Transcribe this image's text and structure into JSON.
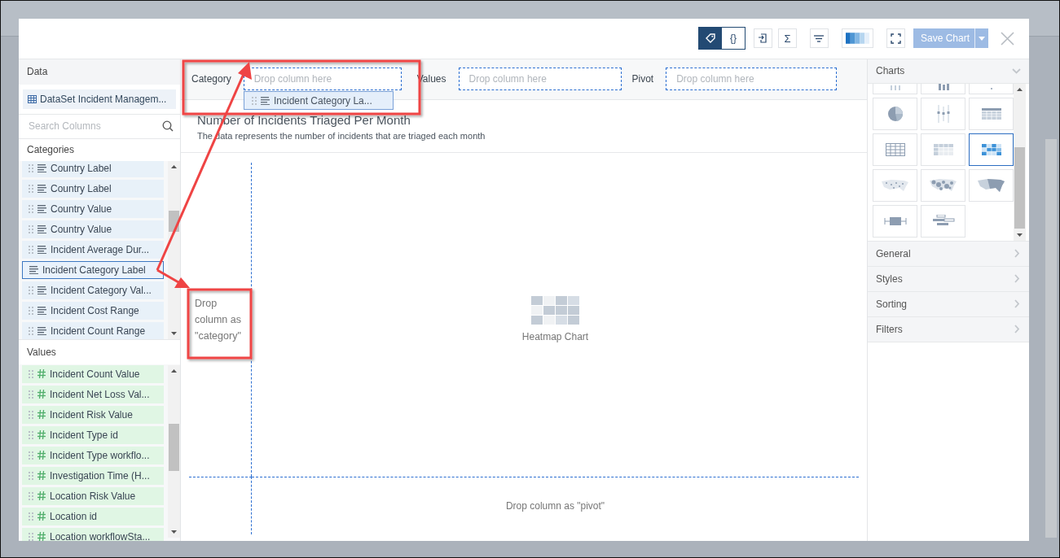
{
  "toolbar": {
    "view_toggle": [
      {
        "kind": "tag",
        "selected": true
      },
      {
        "kind": "code",
        "label": "{}",
        "selected": false
      }
    ],
    "tools": [
      {
        "kind": "export"
      },
      {
        "kind": "sum",
        "label": "Σ"
      },
      {
        "kind": "filter"
      },
      {
        "kind": "palette"
      },
      {
        "kind": "fullscreen"
      }
    ],
    "save_button": {
      "label": "Save Chart",
      "disabled": true
    }
  },
  "data_panel": {
    "title": "Data",
    "dataset": "DataSet Incident Managem...",
    "search": {
      "placeholder": "Search Columns"
    },
    "categories": {
      "title": "Categories",
      "items": [
        {
          "label": "Country Label",
          "dragging": false
        },
        {
          "label": "Country Label",
          "dragging": false
        },
        {
          "label": "Country Value",
          "dragging": false
        },
        {
          "label": "Country Value",
          "dragging": false
        },
        {
          "label": "Incident Average Dur...",
          "dragging": false
        },
        {
          "label": "Incident Category Label",
          "dragging": true
        },
        {
          "label": "Incident Category Val...",
          "dragging": false
        },
        {
          "label": "Incident Cost Range",
          "dragging": false
        },
        {
          "label": "Incident Count Range",
          "dragging": false
        }
      ]
    },
    "values": {
      "title": "Values",
      "items": [
        {
          "label": "Incident Count Value"
        },
        {
          "label": "Incident Net Loss Val..."
        },
        {
          "label": "Incident Risk Value"
        },
        {
          "label": "Incident Type id"
        },
        {
          "label": "Incident Type workflo..."
        },
        {
          "label": "Investigation Time (H..."
        },
        {
          "label": "Location Risk Value"
        },
        {
          "label": "Location id"
        },
        {
          "label": "Location workflowSta..."
        }
      ]
    }
  },
  "drop_bar": [
    {
      "label": "Category",
      "placeholder": "Drop column here"
    },
    {
      "label": "Values",
      "placeholder": "Drop column here"
    },
    {
      "label": "Pivot",
      "placeholder": "Drop column here"
    }
  ],
  "drag_ghost": {
    "label": "Incident Category La..."
  },
  "chart": {
    "title": "Number of Incidents Triaged Per Month",
    "description": "The data represents the number of incidents that are triaged each month",
    "category_hint": "Drop column as \"category\"",
    "type_label": "Heatmap Chart",
    "pivot_hint": "Drop column as \"pivot\""
  },
  "settings_panel": {
    "charts_title": "Charts",
    "chart_types": [
      {
        "kind": "bar",
        "selected": false
      },
      {
        "kind": "column",
        "selected": false
      },
      {
        "kind": "dot",
        "selected": false
      },
      {
        "kind": "pie",
        "selected": false
      },
      {
        "kind": "boxplot",
        "selected": false
      },
      {
        "kind": "table",
        "selected": false
      },
      {
        "kind": "grid",
        "selected": false
      },
      {
        "kind": "pivot",
        "selected": false
      },
      {
        "kind": "heatmap",
        "selected": true
      },
      {
        "kind": "dotmap",
        "selected": false
      },
      {
        "kind": "bubblemap",
        "selected": false
      },
      {
        "kind": "choropleth",
        "selected": false
      },
      {
        "kind": "hbox",
        "selected": false
      },
      {
        "kind": "gantt",
        "selected": false
      }
    ],
    "sections": [
      "General",
      "Styles",
      "Sorting",
      "Filters"
    ]
  }
}
